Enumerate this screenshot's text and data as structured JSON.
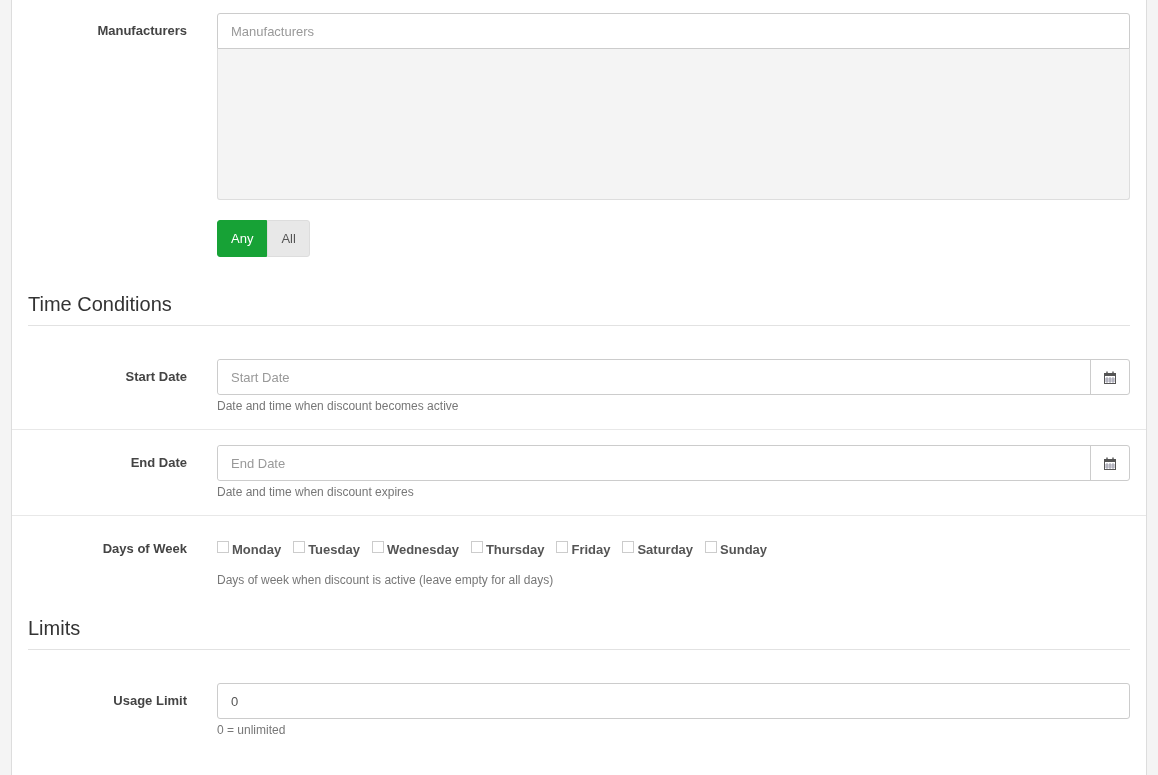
{
  "manufacturers": {
    "label": "Manufacturers",
    "placeholder": "Manufacturers",
    "match": [
      {
        "label": "Any",
        "selected": true
      },
      {
        "label": "All",
        "selected": false
      }
    ]
  },
  "sections": [
    {
      "title": "Time Conditions",
      "fields": [
        {
          "kind": "date",
          "label": "Start Date",
          "placeholder": "Start Date",
          "help": "Date and time when discount becomes active"
        },
        {
          "kind": "date",
          "label": "End Date",
          "placeholder": "End Date",
          "help": "Date and time when discount expires"
        },
        {
          "kind": "days",
          "label": "Days of Week",
          "days": [
            {
              "label": "Monday",
              "checked": false
            },
            {
              "label": "Tuesday",
              "checked": false
            },
            {
              "label": "Wednesday",
              "checked": false
            },
            {
              "label": "Thursday",
              "checked": false
            },
            {
              "label": "Friday",
              "checked": false
            },
            {
              "label": "Saturday",
              "checked": false
            },
            {
              "label": "Sunday",
              "checked": false
            }
          ],
          "help": "Days of week when discount is active (leave empty for all days)"
        }
      ]
    },
    {
      "title": "Limits",
      "fields": [
        {
          "kind": "text",
          "label": "Usage Limit",
          "value": "0",
          "help": "0 = unlimited"
        }
      ]
    }
  ]
}
